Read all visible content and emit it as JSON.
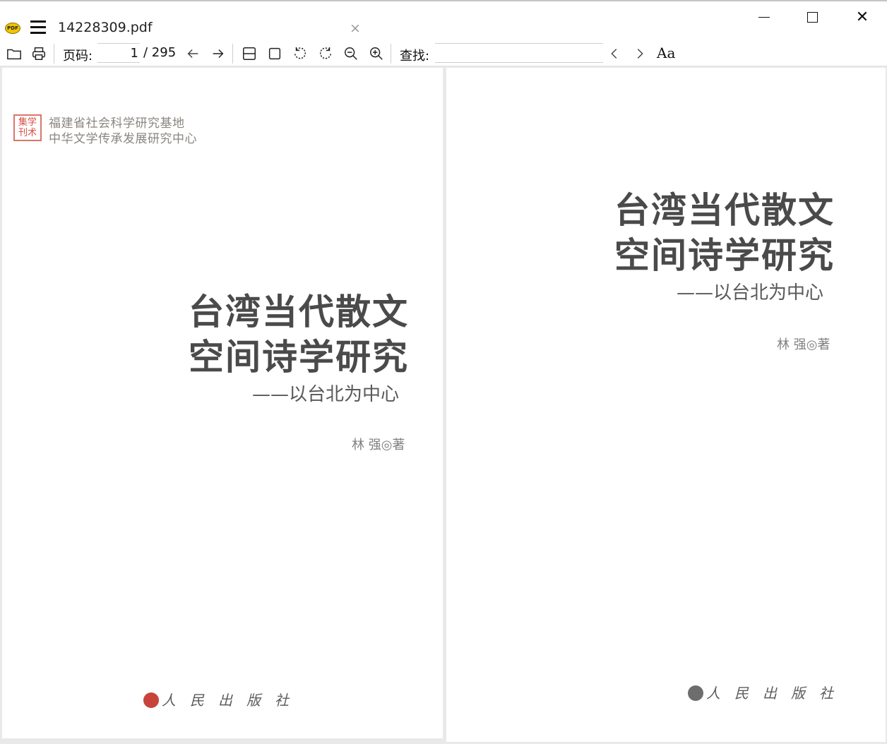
{
  "window": {
    "file_name": "14228309.pdf",
    "app_icon_text": "PDF",
    "tab_close": "×",
    "close_glyph": "✕"
  },
  "toolbar": {
    "page_label": "页码:",
    "current_page": "1",
    "total_pages": "/ 295",
    "find_label": "查找:",
    "find_value": "",
    "font_button": "Aa"
  },
  "left_page": {
    "seal_text": "集学刊术",
    "institution_line1": "福建省社会科学研究基地",
    "institution_line2": "中华文学传承发展研究中心",
    "title_line1": "台湾当代散文",
    "title_line2": "空间诗学研究",
    "subtitle": "——以台北为中心",
    "author": "林  强◎著",
    "publisher": "人民出版社"
  },
  "right_page": {
    "title_line1": "台湾当代散文",
    "title_line2": "空间诗学研究",
    "subtitle": "——以台北为中心",
    "author": "林  强◎著",
    "publisher": "人民出版社"
  },
  "colors": {
    "seal_red": "#d64f43",
    "publisher_logo_red": "#c8443a"
  }
}
